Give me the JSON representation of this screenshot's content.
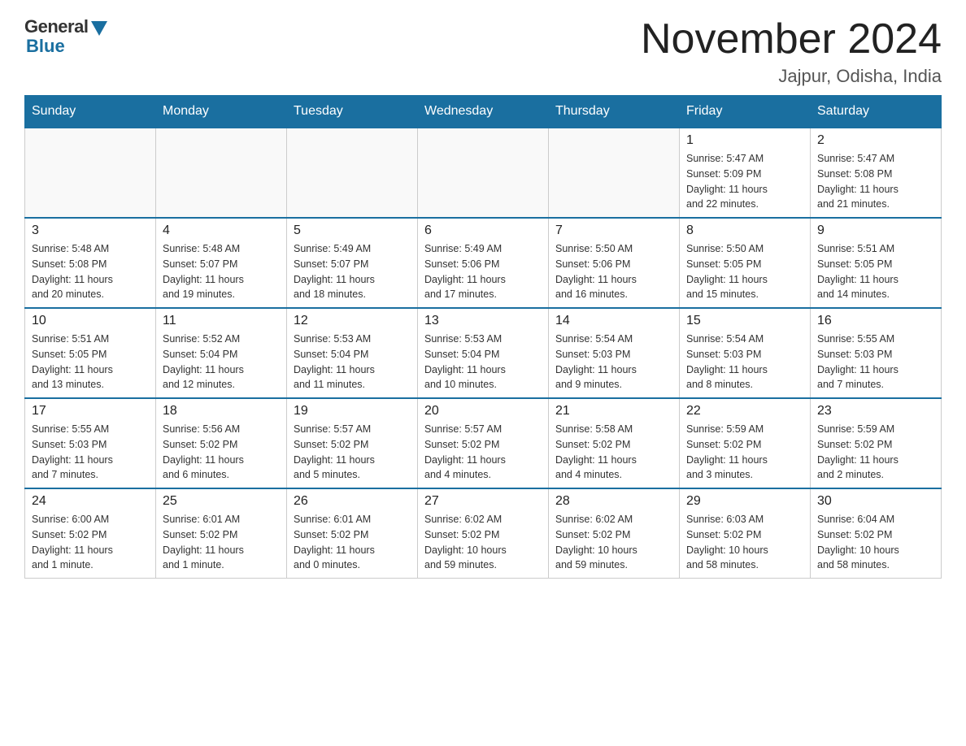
{
  "logo": {
    "general": "General",
    "blue": "Blue"
  },
  "title": "November 2024",
  "location": "Jajpur, Odisha, India",
  "weekdays": [
    "Sunday",
    "Monday",
    "Tuesday",
    "Wednesday",
    "Thursday",
    "Friday",
    "Saturday"
  ],
  "weeks": [
    [
      {
        "day": "",
        "info": ""
      },
      {
        "day": "",
        "info": ""
      },
      {
        "day": "",
        "info": ""
      },
      {
        "day": "",
        "info": ""
      },
      {
        "day": "",
        "info": ""
      },
      {
        "day": "1",
        "info": "Sunrise: 5:47 AM\nSunset: 5:09 PM\nDaylight: 11 hours\nand 22 minutes."
      },
      {
        "day": "2",
        "info": "Sunrise: 5:47 AM\nSunset: 5:08 PM\nDaylight: 11 hours\nand 21 minutes."
      }
    ],
    [
      {
        "day": "3",
        "info": "Sunrise: 5:48 AM\nSunset: 5:08 PM\nDaylight: 11 hours\nand 20 minutes."
      },
      {
        "day": "4",
        "info": "Sunrise: 5:48 AM\nSunset: 5:07 PM\nDaylight: 11 hours\nand 19 minutes."
      },
      {
        "day": "5",
        "info": "Sunrise: 5:49 AM\nSunset: 5:07 PM\nDaylight: 11 hours\nand 18 minutes."
      },
      {
        "day": "6",
        "info": "Sunrise: 5:49 AM\nSunset: 5:06 PM\nDaylight: 11 hours\nand 17 minutes."
      },
      {
        "day": "7",
        "info": "Sunrise: 5:50 AM\nSunset: 5:06 PM\nDaylight: 11 hours\nand 16 minutes."
      },
      {
        "day": "8",
        "info": "Sunrise: 5:50 AM\nSunset: 5:05 PM\nDaylight: 11 hours\nand 15 minutes."
      },
      {
        "day": "9",
        "info": "Sunrise: 5:51 AM\nSunset: 5:05 PM\nDaylight: 11 hours\nand 14 minutes."
      }
    ],
    [
      {
        "day": "10",
        "info": "Sunrise: 5:51 AM\nSunset: 5:05 PM\nDaylight: 11 hours\nand 13 minutes."
      },
      {
        "day": "11",
        "info": "Sunrise: 5:52 AM\nSunset: 5:04 PM\nDaylight: 11 hours\nand 12 minutes."
      },
      {
        "day": "12",
        "info": "Sunrise: 5:53 AM\nSunset: 5:04 PM\nDaylight: 11 hours\nand 11 minutes."
      },
      {
        "day": "13",
        "info": "Sunrise: 5:53 AM\nSunset: 5:04 PM\nDaylight: 11 hours\nand 10 minutes."
      },
      {
        "day": "14",
        "info": "Sunrise: 5:54 AM\nSunset: 5:03 PM\nDaylight: 11 hours\nand 9 minutes."
      },
      {
        "day": "15",
        "info": "Sunrise: 5:54 AM\nSunset: 5:03 PM\nDaylight: 11 hours\nand 8 minutes."
      },
      {
        "day": "16",
        "info": "Sunrise: 5:55 AM\nSunset: 5:03 PM\nDaylight: 11 hours\nand 7 minutes."
      }
    ],
    [
      {
        "day": "17",
        "info": "Sunrise: 5:55 AM\nSunset: 5:03 PM\nDaylight: 11 hours\nand 7 minutes."
      },
      {
        "day": "18",
        "info": "Sunrise: 5:56 AM\nSunset: 5:02 PM\nDaylight: 11 hours\nand 6 minutes."
      },
      {
        "day": "19",
        "info": "Sunrise: 5:57 AM\nSunset: 5:02 PM\nDaylight: 11 hours\nand 5 minutes."
      },
      {
        "day": "20",
        "info": "Sunrise: 5:57 AM\nSunset: 5:02 PM\nDaylight: 11 hours\nand 4 minutes."
      },
      {
        "day": "21",
        "info": "Sunrise: 5:58 AM\nSunset: 5:02 PM\nDaylight: 11 hours\nand 4 minutes."
      },
      {
        "day": "22",
        "info": "Sunrise: 5:59 AM\nSunset: 5:02 PM\nDaylight: 11 hours\nand 3 minutes."
      },
      {
        "day": "23",
        "info": "Sunrise: 5:59 AM\nSunset: 5:02 PM\nDaylight: 11 hours\nand 2 minutes."
      }
    ],
    [
      {
        "day": "24",
        "info": "Sunrise: 6:00 AM\nSunset: 5:02 PM\nDaylight: 11 hours\nand 1 minute."
      },
      {
        "day": "25",
        "info": "Sunrise: 6:01 AM\nSunset: 5:02 PM\nDaylight: 11 hours\nand 1 minute."
      },
      {
        "day": "26",
        "info": "Sunrise: 6:01 AM\nSunset: 5:02 PM\nDaylight: 11 hours\nand 0 minutes."
      },
      {
        "day": "27",
        "info": "Sunrise: 6:02 AM\nSunset: 5:02 PM\nDaylight: 10 hours\nand 59 minutes."
      },
      {
        "day": "28",
        "info": "Sunrise: 6:02 AM\nSunset: 5:02 PM\nDaylight: 10 hours\nand 59 minutes."
      },
      {
        "day": "29",
        "info": "Sunrise: 6:03 AM\nSunset: 5:02 PM\nDaylight: 10 hours\nand 58 minutes."
      },
      {
        "day": "30",
        "info": "Sunrise: 6:04 AM\nSunset: 5:02 PM\nDaylight: 10 hours\nand 58 minutes."
      }
    ]
  ]
}
